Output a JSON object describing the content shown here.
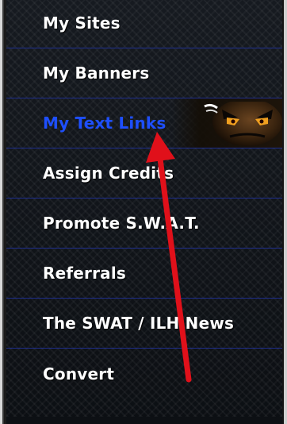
{
  "menu": {
    "items": [
      {
        "label": "My Sites",
        "active": false
      },
      {
        "label": "My Banners",
        "active": false
      },
      {
        "label": "My Text Links",
        "active": true
      },
      {
        "label": "Assign Credits",
        "active": false
      },
      {
        "label": "Promote S.W.A.T.",
        "active": false
      },
      {
        "label": "Referrals",
        "active": false
      },
      {
        "label": "The SWAT / ILH News",
        "active": false
      },
      {
        "label": "Convert",
        "active": false
      }
    ]
  },
  "colors": {
    "menu_background": "#101318",
    "separator": "#1f2f8f",
    "label": "#ffffff",
    "active_label": "#1e4fff",
    "arrow": "#e0101a"
  },
  "icons": {
    "mascot": "angry-face-mascot-icon",
    "pointer": "red-arrow-annotation"
  }
}
